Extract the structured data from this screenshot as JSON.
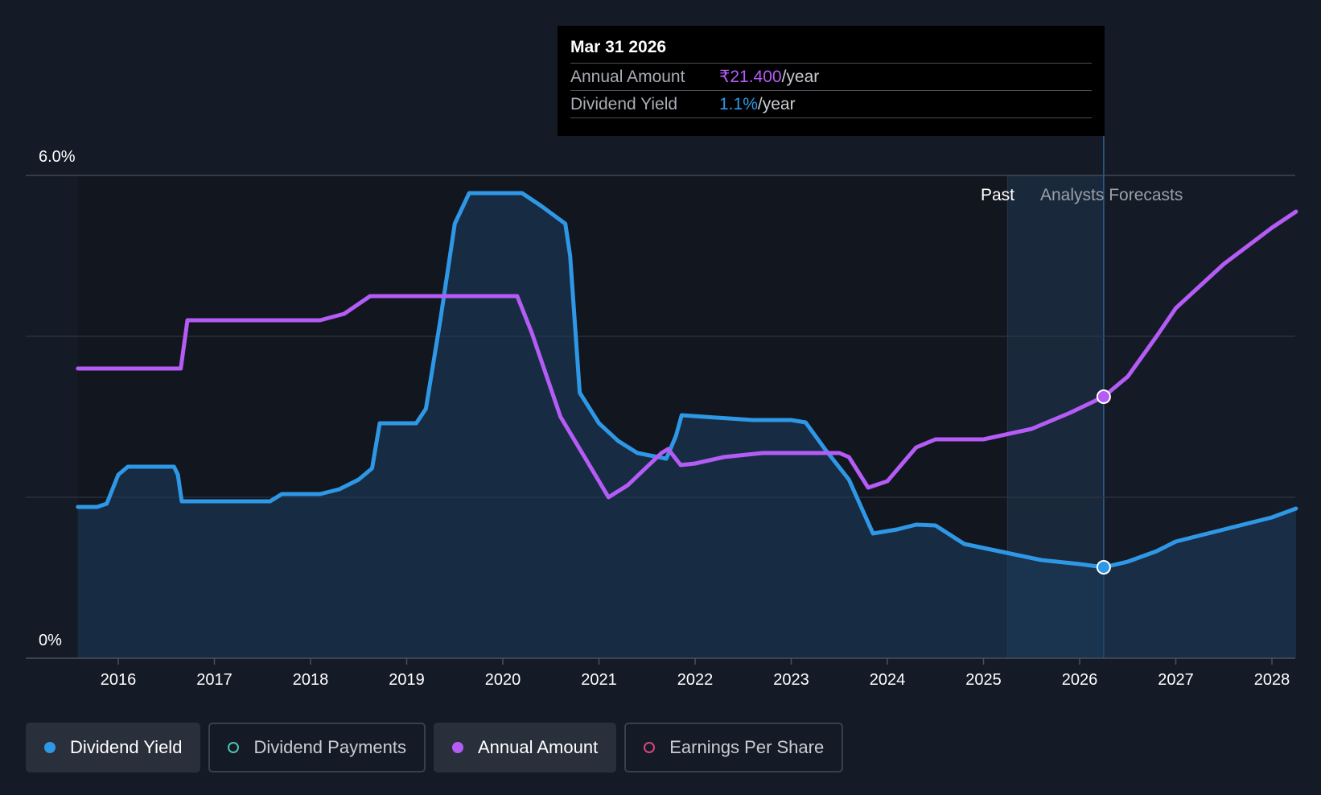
{
  "chart_data": {
    "type": "line",
    "y_axis_labels": [
      "6.0%",
      "0%"
    ],
    "ylim": [
      0,
      6.0
    ],
    "x_ticks": [
      "2016",
      "2017",
      "2018",
      "2019",
      "2020",
      "2021",
      "2022",
      "2023",
      "2024",
      "2025",
      "2026",
      "2027",
      "2028"
    ],
    "regions": {
      "past_label": "Past",
      "forecast_label": "Analysts Forecasts"
    },
    "grid": true,
    "series": [
      {
        "name": "Dividend Yield",
        "unit": "%",
        "color": "#2f98e6",
        "filled": true,
        "points": [
          [
            2015.58,
            1.88
          ],
          [
            2015.78,
            1.88
          ],
          [
            2015.88,
            1.92
          ],
          [
            2016.0,
            2.28
          ],
          [
            2016.1,
            2.38
          ],
          [
            2016.58,
            2.38
          ],
          [
            2016.62,
            2.28
          ],
          [
            2016.66,
            1.95
          ],
          [
            2017.0,
            1.95
          ],
          [
            2017.58,
            1.95
          ],
          [
            2017.62,
            1.98
          ],
          [
            2017.7,
            2.04
          ],
          [
            2018.1,
            2.04
          ],
          [
            2018.3,
            2.1
          ],
          [
            2018.5,
            2.22
          ],
          [
            2018.64,
            2.36
          ],
          [
            2018.72,
            2.92
          ],
          [
            2019.1,
            2.92
          ],
          [
            2019.2,
            3.1
          ],
          [
            2019.35,
            4.2
          ],
          [
            2019.5,
            5.4
          ],
          [
            2019.65,
            5.78
          ],
          [
            2020.0,
            5.78
          ],
          [
            2020.2,
            5.78
          ],
          [
            2020.4,
            5.62
          ],
          [
            2020.65,
            5.4
          ],
          [
            2020.7,
            5.0
          ],
          [
            2020.8,
            3.3
          ],
          [
            2021.0,
            2.92
          ],
          [
            2021.2,
            2.7
          ],
          [
            2021.4,
            2.55
          ],
          [
            2021.7,
            2.48
          ],
          [
            2021.8,
            2.76
          ],
          [
            2021.86,
            3.02
          ],
          [
            2022.1,
            3.0
          ],
          [
            2022.6,
            2.96
          ],
          [
            2023.0,
            2.96
          ],
          [
            2023.15,
            2.93
          ],
          [
            2023.35,
            2.6
          ],
          [
            2023.6,
            2.22
          ],
          [
            2023.85,
            1.55
          ],
          [
            2024.1,
            1.6
          ],
          [
            2024.3,
            1.66
          ],
          [
            2024.5,
            1.65
          ],
          [
            2024.8,
            1.42
          ],
          [
            2025.2,
            1.32
          ],
          [
            2025.6,
            1.22
          ],
          [
            2026.0,
            1.17
          ],
          [
            2026.25,
            1.13
          ],
          [
            2026.5,
            1.2
          ],
          [
            2026.8,
            1.33
          ],
          [
            2027.0,
            1.45
          ],
          [
            2027.5,
            1.6
          ],
          [
            2028.0,
            1.75
          ],
          [
            2028.25,
            1.86
          ]
        ]
      },
      {
        "name": "Annual Amount",
        "color": "#b45cf5",
        "filled": false,
        "points": [
          [
            2015.58,
            3.6
          ],
          [
            2016.5,
            3.6
          ],
          [
            2016.65,
            3.6
          ],
          [
            2016.72,
            4.2
          ],
          [
            2017.0,
            4.2
          ],
          [
            2018.1,
            4.2
          ],
          [
            2018.35,
            4.28
          ],
          [
            2018.62,
            4.5
          ],
          [
            2019.0,
            4.5
          ],
          [
            2020.0,
            4.5
          ],
          [
            2020.15,
            4.5
          ],
          [
            2020.3,
            4.05
          ],
          [
            2020.6,
            3.0
          ],
          [
            2020.9,
            2.4
          ],
          [
            2021.1,
            2.0
          ],
          [
            2021.3,
            2.15
          ],
          [
            2021.65,
            2.55
          ],
          [
            2021.72,
            2.6
          ],
          [
            2021.85,
            2.4
          ],
          [
            2022.0,
            2.42
          ],
          [
            2022.3,
            2.5
          ],
          [
            2022.7,
            2.55
          ],
          [
            2023.2,
            2.55
          ],
          [
            2023.5,
            2.55
          ],
          [
            2023.6,
            2.5
          ],
          [
            2023.8,
            2.12
          ],
          [
            2024.0,
            2.2
          ],
          [
            2024.3,
            2.62
          ],
          [
            2024.5,
            2.72
          ],
          [
            2025.0,
            2.72
          ],
          [
            2025.5,
            2.85
          ],
          [
            2025.9,
            3.05
          ],
          [
            2026.25,
            3.25
          ],
          [
            2026.5,
            3.5
          ],
          [
            2026.8,
            4.0
          ],
          [
            2027.0,
            4.35
          ],
          [
            2027.5,
            4.9
          ],
          [
            2028.0,
            5.35
          ],
          [
            2028.25,
            5.55
          ]
        ]
      }
    ],
    "highlight_x": 2026.25
  },
  "tooltip": {
    "date": "Mar 31 2026",
    "rows": [
      {
        "label": "Annual Amount",
        "value": "₹21.400",
        "unit": "/year"
      },
      {
        "label": "Dividend Yield",
        "value": "1.1%",
        "unit": "/year"
      }
    ]
  },
  "legend": [
    {
      "label": "Dividend Yield",
      "color": "#2f98e6",
      "active": true,
      "filled": true
    },
    {
      "label": "Dividend Payments",
      "color": "#4fc1b3",
      "active": false,
      "filled": false
    },
    {
      "label": "Annual Amount",
      "color": "#b45cf5",
      "active": true,
      "filled": true
    },
    {
      "label": "Earnings Per Share",
      "color": "#d6457f",
      "active": false,
      "filled": false
    }
  ]
}
